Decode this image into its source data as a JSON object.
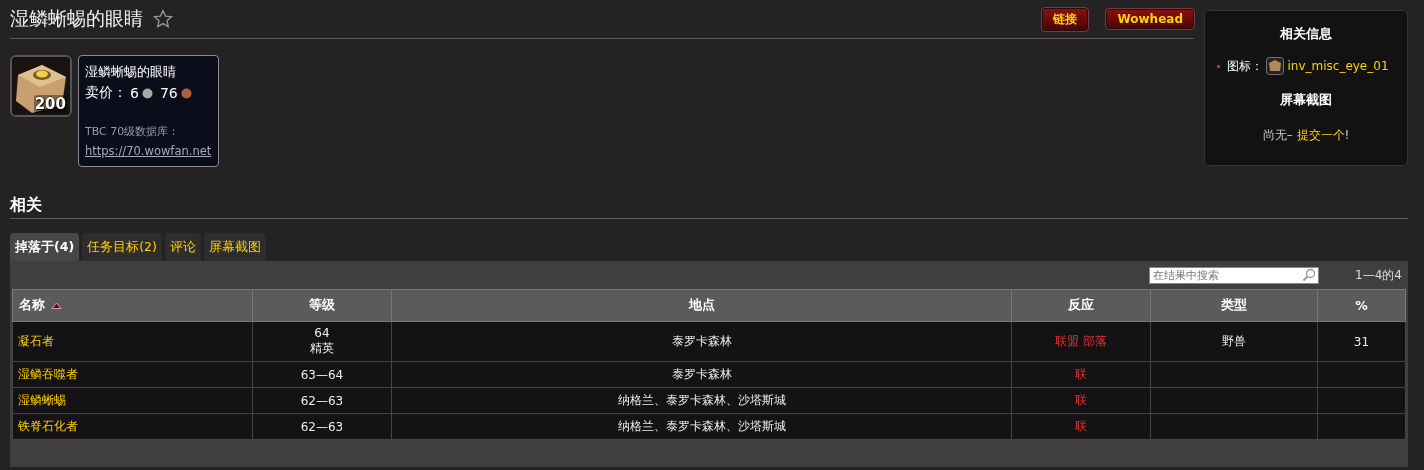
{
  "page_title": "湿鳞蜥蜴的眼睛",
  "header_buttons": [
    "链接",
    "Wowhead"
  ],
  "item": {
    "stack_count": "200",
    "name": "湿鳞蜥蜴的眼睛",
    "price_label": "卖价：",
    "silver": "6",
    "copper": "76",
    "source_note": "TBC 70级数据库：",
    "source_link": "https://70.wowfan.net"
  },
  "infobox": {
    "title": "相关信息",
    "icon_label": "图标：",
    "icon_name": "inv_misc_eye_01",
    "screenshots_title": "屏幕截图",
    "screenshots_text": "尚无– ",
    "screenshots_link": "提交一个",
    "screenshots_end": "!"
  },
  "section_title": "相关",
  "tabs": [
    {
      "label": "掉落于(4)",
      "selected": true
    },
    {
      "label": "任务目标(2)",
      "selected": false
    },
    {
      "label": "评论",
      "selected": false
    },
    {
      "label": "屏幕截图",
      "selected": false
    }
  ],
  "search": {
    "placeholder": "在结果中搜索"
  },
  "result_count": "1—4的4",
  "table": {
    "columns": [
      {
        "label": "名称",
        "sorted": true
      },
      {
        "label": "等级",
        "sorted": false
      },
      {
        "label": "地点",
        "sorted": false
      },
      {
        "label": "反应",
        "sorted": false
      },
      {
        "label": "类型",
        "sorted": false
      },
      {
        "label": "%",
        "sorted": false
      }
    ],
    "rows": [
      {
        "name": "凝石者",
        "level": "64",
        "rank": "精英",
        "location": "泰罗卡森林",
        "reaction": [
          "联盟",
          "部落"
        ],
        "type": "野兽",
        "percent": "31"
      },
      {
        "name": "湿鳞吞噬者",
        "level": "63—64",
        "location": "泰罗卡森林",
        "reaction": [
          "联"
        ]
      },
      {
        "name": "湿鳞蜥蜴",
        "level": "62—63",
        "location": "纳格兰、泰罗卡森林、沙塔斯城",
        "reaction": [
          "联"
        ]
      },
      {
        "name": "铁脊石化者",
        "level": "62—63",
        "location": "纳格兰、泰罗卡森林、沙塔斯城",
        "reaction": [
          "联"
        ]
      }
    ]
  }
}
